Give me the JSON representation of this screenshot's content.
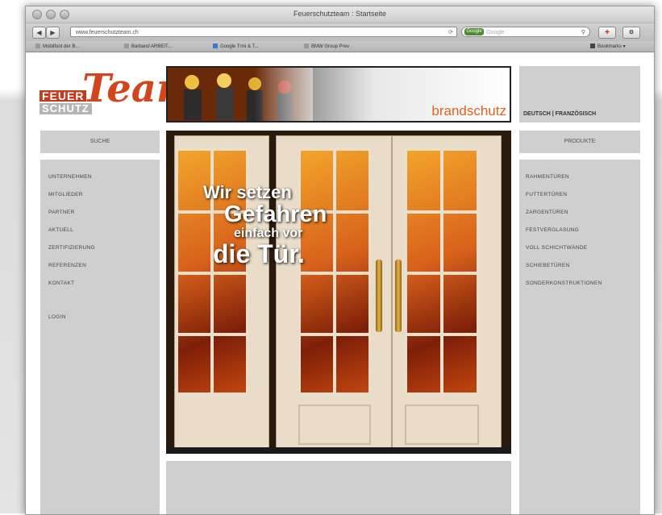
{
  "window": {
    "title": "Feuerschutzteam : Startseite"
  },
  "toolbar": {
    "back_icon": "back-arrow",
    "forward_icon": "forward-arrow",
    "url": "www.feuerschutzteam.ch",
    "search_placeholder": "Google",
    "search_engine": "Google"
  },
  "bookmarks": {
    "items": [
      "Mobilfoot der B...",
      "Barband ARBEIT...",
      "Google Trini & T...",
      "BMW Group Prev"
    ],
    "menu_label": "Bookmarks"
  },
  "logo": {
    "word1": "FEUER",
    "word2": "SCHUTZ",
    "word3": "Team"
  },
  "banner": {
    "brand_text": "brandschutz"
  },
  "language": {
    "label": "DEUTSCH | FRANZÖSISCH"
  },
  "left_nav": {
    "header": "SUCHE",
    "items": [
      "UNTERNEHMEN",
      "MITGLIEDER",
      "PARTNER",
      "AKTUELL",
      "ZERTIFIZIERUNG",
      "REFERENZEN",
      "KONTAKT"
    ],
    "login": "LOGIN"
  },
  "right_nav": {
    "header": "PRODUKTE",
    "items": [
      "RAHMENTÜREN",
      "FUTTERTÜREN",
      "ZARGENTÜREN",
      "FESTVERGLASUNG",
      "VOLL SCHICHTWÄNDE",
      "SCHIEBETÜREN",
      "SONDERKONSTRUKTIONEN"
    ]
  },
  "hero": {
    "line1": "Wir setzen",
    "line2": "Gefahren",
    "line3": "einfach vor",
    "line4": "die Tür."
  },
  "colors": {
    "accent": "#d2461f",
    "panel": "#cfcfcf"
  }
}
